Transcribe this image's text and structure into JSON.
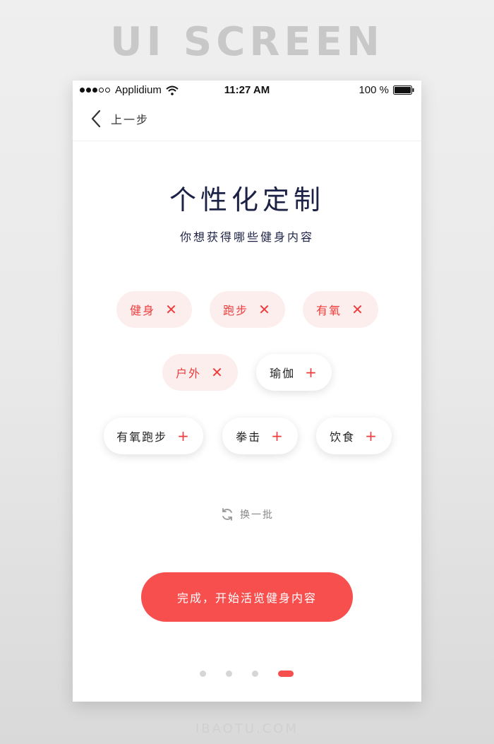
{
  "header_banner": "UI SCREEN",
  "footer_banner": "IBAOTU.COM",
  "status_bar": {
    "carrier": "Applidium",
    "time": "11:27 AM",
    "battery": "100 %"
  },
  "nav": {
    "back_label": "上一步"
  },
  "title": "个性化定制",
  "subtitle": "你想获得哪些健身内容",
  "tags": [
    {
      "label": "健身",
      "selected": true,
      "icon": "close-icon",
      "symbol": "✕"
    },
    {
      "label": "跑步",
      "selected": true,
      "icon": "close-icon",
      "symbol": "✕"
    },
    {
      "label": "有氧",
      "selected": true,
      "icon": "close-icon",
      "symbol": "✕"
    },
    {
      "label": "户外",
      "selected": true,
      "icon": "close-icon",
      "symbol": "✕"
    },
    {
      "label": "瑜伽",
      "selected": false,
      "icon": "plus-icon",
      "symbol": "+"
    },
    {
      "label": "有氧跑步",
      "selected": false,
      "icon": "plus-icon",
      "symbol": "+"
    },
    {
      "label": "拳击",
      "selected": false,
      "icon": "plus-icon",
      "symbol": "+"
    },
    {
      "label": "饮食",
      "selected": false,
      "icon": "plus-icon",
      "symbol": "+"
    }
  ],
  "refresh_label": "换一批",
  "complete_button": "完成，开始活览健身内容",
  "pagination": {
    "total": 4,
    "active": 4
  },
  "colors": {
    "accent": "#f74e4e",
    "selected_tag_bg": "#fdeeee",
    "title": "#1c2245"
  }
}
